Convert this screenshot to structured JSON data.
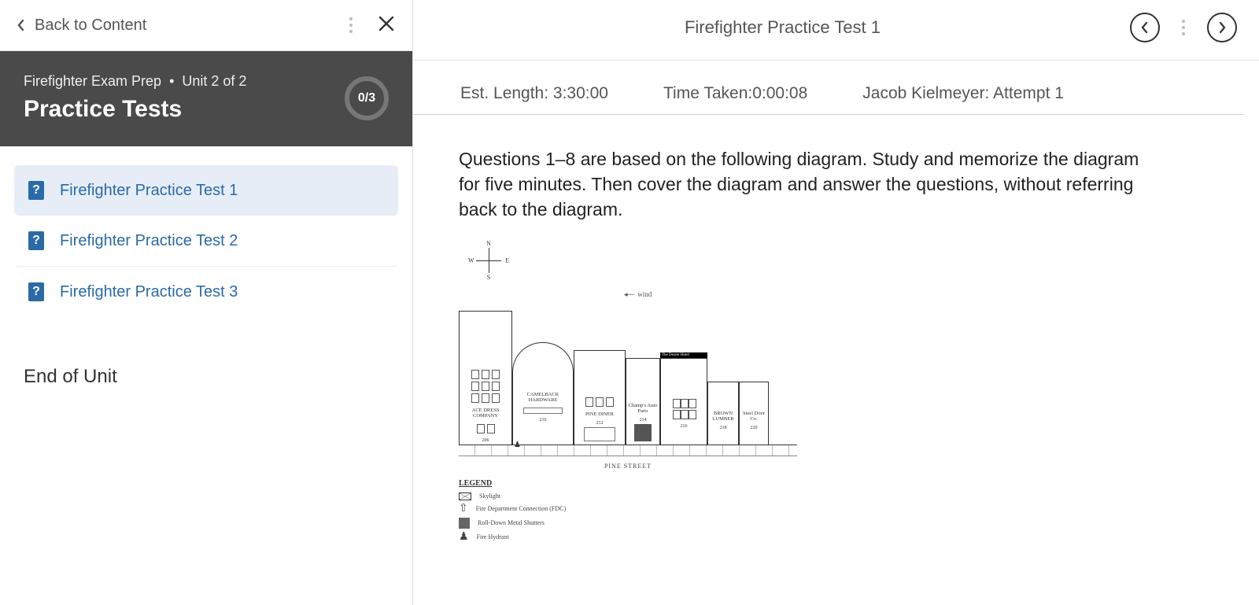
{
  "sidebar": {
    "back_label": "Back to Content",
    "course_name": "Firefighter Exam Prep",
    "unit_meta": "Unit 2 of 2",
    "unit_title": "Practice Tests",
    "progress": "0/3",
    "items": [
      {
        "label": "Firefighter Practice Test 1",
        "active": true
      },
      {
        "label": "Firefighter Practice Test 2",
        "active": false
      },
      {
        "label": "Firefighter Practice Test 3",
        "active": false
      }
    ],
    "end_label": "End of Unit"
  },
  "main": {
    "title": "Firefighter Practice Test 1",
    "info": {
      "est_label": "Est. Length: ",
      "est_value": "3:30:00",
      "time_label": "Time Taken:",
      "time_value": "0:00:08",
      "attempt_label": "Jacob Kielmeyer: Attempt 1"
    },
    "instructions": "Questions 1–8 are based on the following diagram. Study and memorize the diagram for five minutes. Then cover the diagram and answer the questions, without referring back to the diagram.",
    "diagram": {
      "compass": {
        "n": "N",
        "s": "S",
        "e": "E",
        "w": "W"
      },
      "wind_label": "wind",
      "buildings": [
        {
          "name": "ACE DRESS COMPANY",
          "addr": "206"
        },
        {
          "name": "CAMELBACK HARDWARE",
          "addr": "210"
        },
        {
          "name": "PINE DINER",
          "addr": "212"
        },
        {
          "name": "Champ's Auto Parts",
          "addr": "214"
        },
        {
          "sign": "The Dexter Hotel",
          "addr": "216"
        },
        {
          "name": "BROWN LUMBER",
          "addr": "218"
        },
        {
          "name": "Steel Door Co.",
          "addr": "220"
        }
      ],
      "street": "PINE STREET",
      "legend_title": "LEGEND",
      "legend": [
        "Skylight",
        "Fire Department Connection (FDC)",
        "Roll-Down Metal Shutters",
        "Fire Hydrant"
      ]
    }
  }
}
